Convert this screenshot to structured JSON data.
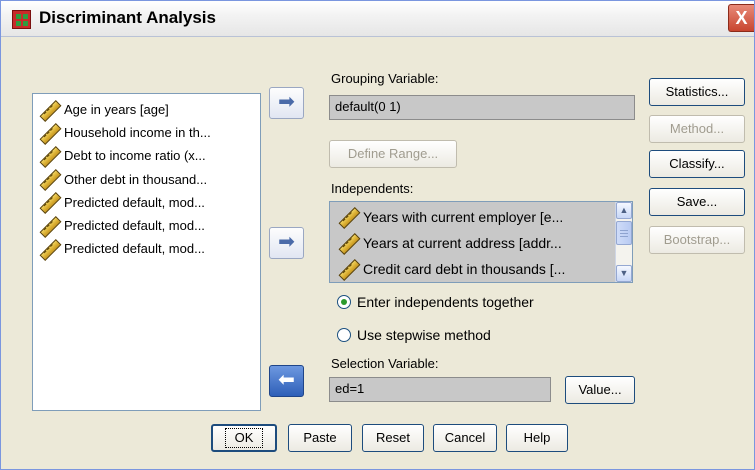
{
  "window": {
    "title": "Discriminant Analysis",
    "close_glyph": "X"
  },
  "source_vars": [
    {
      "label": "Age in years [age]",
      "icon": "ruler-icon"
    },
    {
      "label": "Household income in th...",
      "icon": "ruler-icon"
    },
    {
      "label": "Debt to income ratio (x...",
      "icon": "ruler-icon"
    },
    {
      "label": "Other debt in thousand...",
      "icon": "ruler-icon"
    },
    {
      "label": "Predicted default, mod...",
      "icon": "ruler-icon"
    },
    {
      "label": "Predicted default, mod...",
      "icon": "ruler-icon"
    },
    {
      "label": "Predicted default, mod...",
      "icon": "ruler-icon"
    }
  ],
  "grouping": {
    "label": "Grouping Variable:",
    "value": "default(0 1)",
    "define_range": "Define Range..."
  },
  "independents": {
    "label": "Independents:",
    "items": [
      "Years with current employer [e...",
      "Years at current address [addr...",
      "Credit card debt in thousands [..."
    ]
  },
  "radios": {
    "enter_together": {
      "label": "Enter independents together",
      "checked": true
    },
    "stepwise": {
      "label": "Use stepwise method",
      "checked": false
    }
  },
  "selection": {
    "label": "Selection Variable:",
    "value": "ed=1",
    "value_button": "Value..."
  },
  "side_buttons": {
    "statistics": "Statistics...",
    "method": "Method...",
    "classify": "Classify...",
    "save": "Save...",
    "bootstrap": "Bootstrap..."
  },
  "bottom_buttons": {
    "ok": "OK",
    "paste": "Paste",
    "reset": "Reset",
    "cancel": "Cancel",
    "help": "Help"
  },
  "arrows": {
    "right": "➡",
    "left": "⬅"
  },
  "colors": {
    "window_bg": "#ece9d8",
    "field_bg": "#c8c8c8",
    "radio_dot": "#2c9a2c",
    "close_red": "#c8452f"
  }
}
